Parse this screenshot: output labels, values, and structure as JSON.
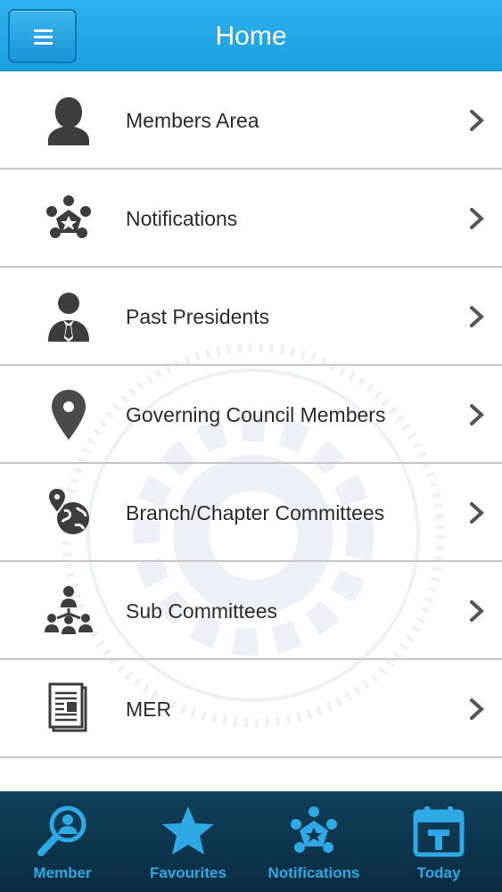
{
  "header": {
    "title": "Home",
    "menu_icon": "hamburger-icon"
  },
  "list": {
    "items": [
      {
        "label": "Members Area",
        "icon": "member-silhouette-icon"
      },
      {
        "label": "Notifications",
        "icon": "network-people-icon"
      },
      {
        "label": "Past Presidents",
        "icon": "businessman-icon"
      },
      {
        "label": "Governing Council Members",
        "icon": "map-pin-icon"
      },
      {
        "label": "Branch/Chapter Committees",
        "icon": "globe-pin-icon"
      },
      {
        "label": "Sub Committees",
        "icon": "org-chart-people-icon"
      },
      {
        "label": "MER",
        "icon": "document-icon"
      }
    ]
  },
  "tabbar": {
    "tabs": [
      {
        "label": "Member",
        "icon": "member-search-icon"
      },
      {
        "label": "Favourites",
        "icon": "star-icon"
      },
      {
        "label": "Notifications",
        "icon": "network-people-icon"
      },
      {
        "label": "Today",
        "icon": "calendar-today-icon"
      }
    ]
  },
  "colors": {
    "header": "#1fa5e6",
    "tabbar": "#0c3550",
    "tab_label": "#2ea9e6",
    "row_text": "#2b2b2b"
  }
}
